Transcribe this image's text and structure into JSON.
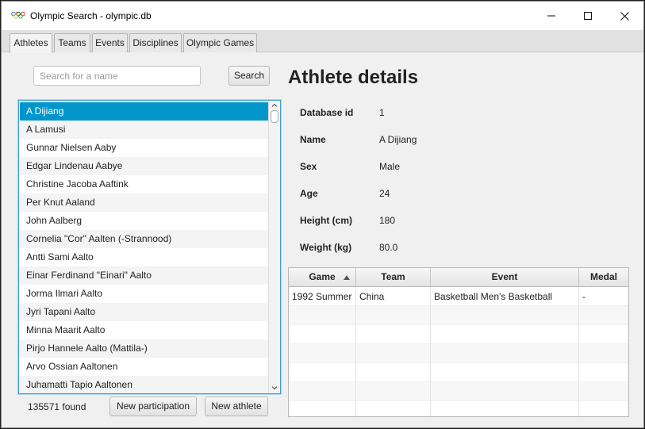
{
  "window": {
    "title": "Olympic Search - olympic.db",
    "app_icon": "olympic-rings-icon"
  },
  "tabs": [
    {
      "label": "Athletes",
      "active": true
    },
    {
      "label": "Teams",
      "active": false
    },
    {
      "label": "Events",
      "active": false
    },
    {
      "label": "Disciplines",
      "active": false
    },
    {
      "label": "Olympic Games",
      "active": false
    }
  ],
  "search": {
    "placeholder": "Search for a name",
    "value": "",
    "button_label": "Search"
  },
  "athlete_list": {
    "selected_index": 0,
    "items": [
      "A Dijiang",
      "A Lamusi",
      "Gunnar Nielsen Aaby",
      "Edgar Lindenau Aabye",
      "Christine Jacoba Aaftink",
      "Per Knut Aaland",
      "John Aalberg",
      "Cornelia \"Cor\" Aalten (-Strannood)",
      "Antti Sami Aalto",
      "Einar Ferdinand \"Einari\" Aalto",
      "Jorma Ilmari Aalto",
      "Jyri Tapani Aalto",
      "Minna Maarit Aalto",
      "Pirjo Hannele Aalto (Mattila-)",
      "Arvo Ossian Aaltonen",
      "Juhamatti Tapio Aaltonen"
    ]
  },
  "footer": {
    "found_text": "135571  found",
    "new_participation_label": "New participation",
    "new_athlete_label": "New athlete"
  },
  "details": {
    "title": "Athlete details",
    "fields": [
      {
        "label": "Database id",
        "value": "1"
      },
      {
        "label": "Name",
        "value": "A Dijiang"
      },
      {
        "label": "Sex",
        "value": "Male"
      },
      {
        "label": "Age",
        "value": "24"
      },
      {
        "label": "Height (cm)",
        "value": "180"
      },
      {
        "label": "Weight (kg)",
        "value": "80.0"
      }
    ]
  },
  "participations": {
    "columns": [
      "Game",
      "Team",
      "Event",
      "Medal"
    ],
    "sort_column": "Game",
    "sort_direction": "ascending",
    "rows": [
      [
        "1992 Summer",
        "China",
        "Basketball Men's Basketball",
        "-"
      ]
    ]
  },
  "colors": {
    "selection": "#0096c9",
    "focus_border": "#3c9fd8"
  }
}
